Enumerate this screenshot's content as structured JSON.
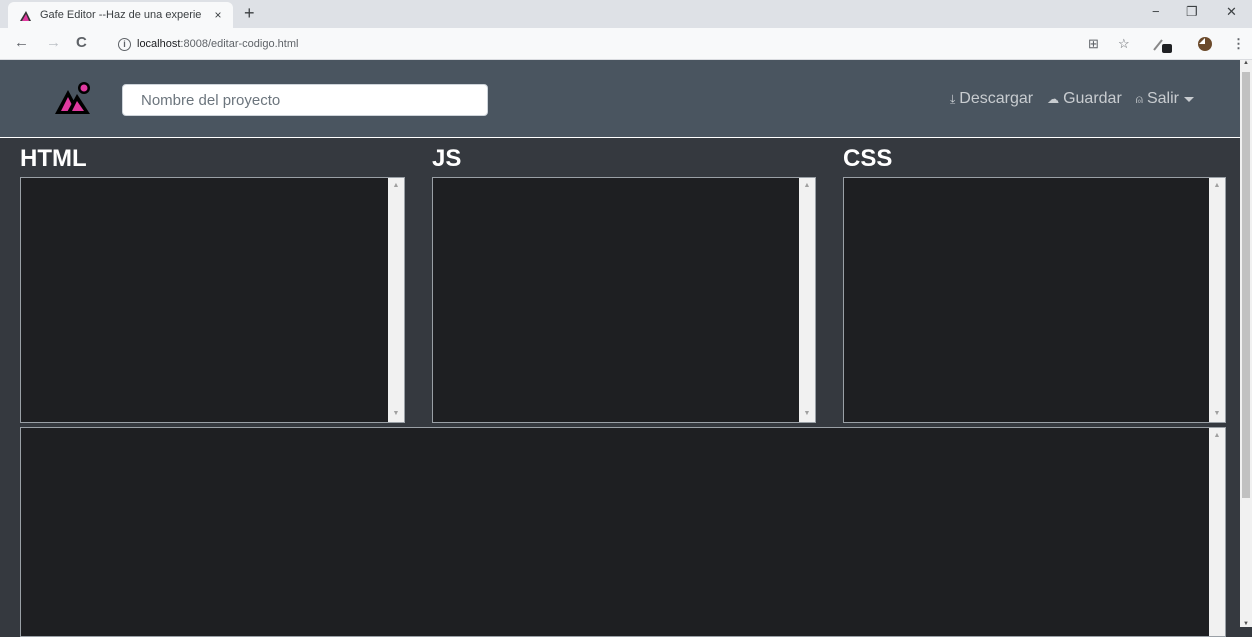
{
  "browser": {
    "tab_title": "Gafe Editor --Haz de una experie",
    "tab_close": "×",
    "new_tab": "+",
    "url_host": "localhost",
    "url_path": ":8008/editar-codigo.html",
    "back": "←",
    "forward": "→",
    "reload": "C",
    "info": "i",
    "minimize": "−",
    "restore": "❐",
    "close": "✕",
    "translate": "⊞",
    "bookmark": "☆",
    "menu": "⋮"
  },
  "app": {
    "project_placeholder": "Nombre del proyecto",
    "nav": {
      "download": "Descargar",
      "save": "Guardar",
      "logout": "Salir"
    },
    "nav_icons": {
      "download": "⤓",
      "save": "☁",
      "logout": "⍝"
    },
    "editors": {
      "html_label": "HTML",
      "js_label": "JS",
      "css_label": "CSS"
    },
    "colors": {
      "header_bg": "#4a5560",
      "body_bg": "#35393f",
      "editor_bg": "#1e1f22",
      "logo_accent": "#e03aa0"
    }
  }
}
